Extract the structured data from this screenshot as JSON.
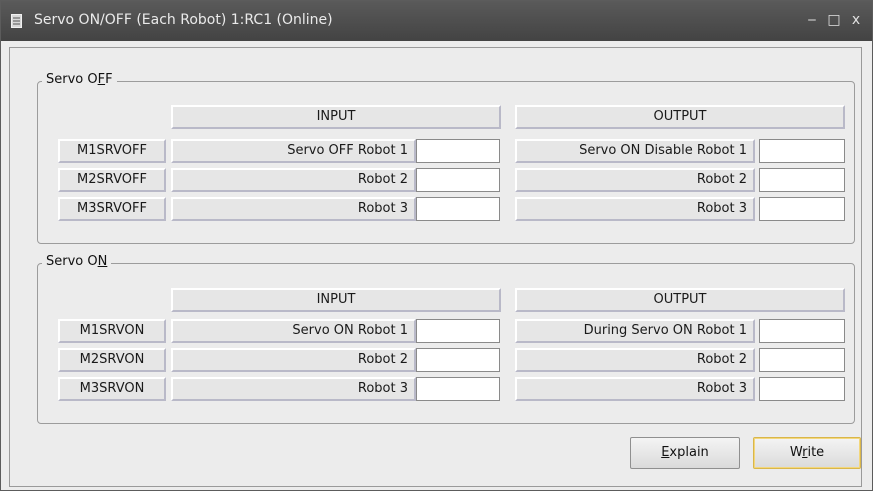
{
  "window": {
    "title": "Servo ON/OFF (Each Robot) 1:RC1 (Online)",
    "controls": {
      "minimize": "‒",
      "maximize": "□",
      "close": "x"
    }
  },
  "servo_off": {
    "legend_prefix": "Servo O",
    "legend_accel": "F",
    "legend_suffix": "F",
    "input_header": "INPUT",
    "output_header": "OUTPUT",
    "rows": [
      {
        "label": "M1SRVOFF",
        "input_desc": "Servo OFF Robot 1",
        "input_value": "",
        "output_desc": "Servo ON Disable Robot 1",
        "output_value": ""
      },
      {
        "label": "M2SRVOFF",
        "input_desc": "Robot 2",
        "input_value": "",
        "output_desc": "Robot 2",
        "output_value": ""
      },
      {
        "label": "M3SRVOFF",
        "input_desc": "Robot 3",
        "input_value": "",
        "output_desc": "Robot 3",
        "output_value": ""
      }
    ]
  },
  "servo_on": {
    "legend_prefix": "Servo O",
    "legend_accel": "N",
    "input_header": "INPUT",
    "output_header": "OUTPUT",
    "rows": [
      {
        "label": "M1SRVON",
        "input_desc": "Servo ON Robot 1",
        "input_value": "",
        "output_desc": "During Servo ON Robot 1",
        "output_value": ""
      },
      {
        "label": "M2SRVON",
        "input_desc": "Robot 2",
        "input_value": "",
        "output_desc": "Robot 2",
        "output_value": ""
      },
      {
        "label": "M3SRVON",
        "input_desc": "Robot 3",
        "input_value": "",
        "output_desc": "Robot 3",
        "output_value": ""
      }
    ]
  },
  "buttons": {
    "explain_accel": "E",
    "explain_rest": "xplain",
    "write_prefix": "W",
    "write_accel": "r",
    "write_suffix": "ite"
  }
}
